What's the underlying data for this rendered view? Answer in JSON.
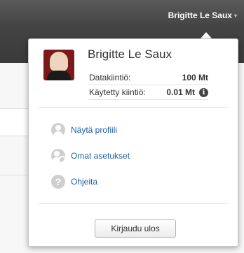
{
  "header": {
    "user_menu_label": "Brigitte Le Saux",
    "caret": "▾"
  },
  "popup": {
    "user_name": "Brigitte Le Saux",
    "quota": [
      {
        "label": "Datakiintiö:",
        "value": "100 Mt"
      },
      {
        "label": "Käytetty kiintiö:",
        "value": "0.01 Mt"
      }
    ],
    "info_glyph": "i",
    "menu": [
      {
        "label": "Näytä profiili",
        "icon": "person-icon"
      },
      {
        "label": "Omat asetukset",
        "icon": "person-settings-icon"
      },
      {
        "label": "Ohjeita",
        "icon": "help-icon"
      }
    ],
    "help_glyph": "?",
    "logout_label": "Kirjaudu ulos"
  },
  "colors": {
    "topbar": "#3f3f3f",
    "link": "#1f5fa6",
    "avatar_bg": "#7a1a1a"
  }
}
